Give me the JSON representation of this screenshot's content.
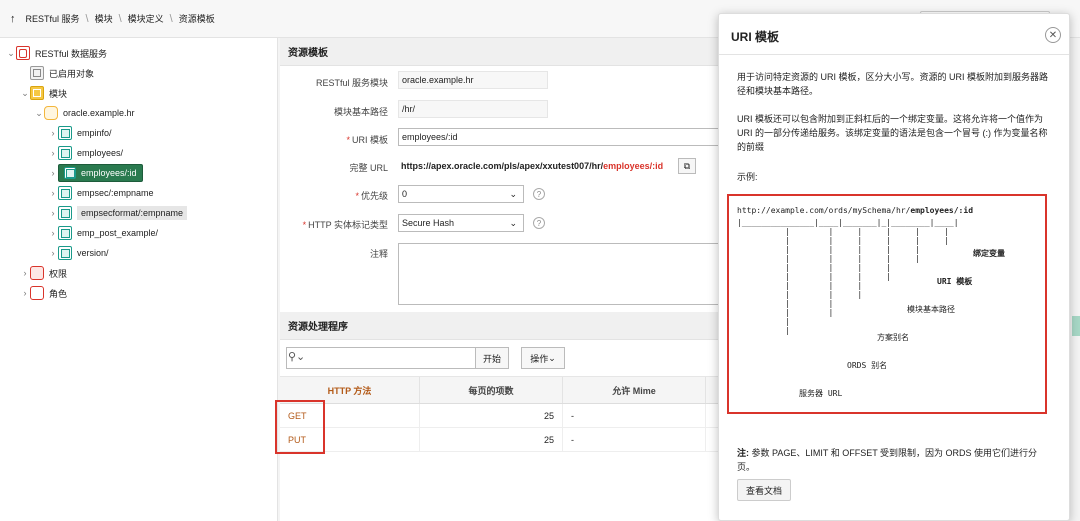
{
  "breadcrumb": {
    "items": [
      "RESTful 服务",
      "模块",
      "模块定义",
      "资源模板"
    ]
  },
  "tree": {
    "root": "RESTful 数据服务",
    "enabled_objects": "已启用对象",
    "modules": "模块",
    "module": "oracle.example.hr",
    "templates": [
      "empinfo/",
      "employees/",
      "employees/:id",
      "empsec/:empname",
      "empsecformat/:empname",
      "emp_post_example/",
      "version/"
    ],
    "selected": "employees/:id",
    "privileges": "权限",
    "roles": "角色"
  },
  "form": {
    "title": "资源模板",
    "module_label": "RESTful 服务模块",
    "module_value": "oracle.example.hr",
    "base_path_label": "模块基本路径",
    "base_path_value": "/hr/",
    "uri_label": "URI 模板",
    "uri_value": "employees/:id",
    "full_url_label": "完整 URL",
    "full_url_prefix": "https://apex.oracle.com/pls/apex/xxutest007/hr/",
    "full_url_suffix": "employees/:id",
    "priority_label": "优先级",
    "priority_value": "0",
    "etag_label": "HTTP 实体标记类型",
    "etag_value": "Secure Hash",
    "comments_label": "注释"
  },
  "handlers": {
    "title": "资源处理程序",
    "go_button": "开始",
    "actions_button": "操作",
    "columns": [
      "HTTP 方法",
      "每页的项数",
      "允许 Mime"
    ],
    "rows": [
      {
        "method": "GET",
        "items": "25",
        "mime": "-"
      },
      {
        "method": "PUT",
        "items": "25",
        "mime": "-"
      }
    ]
  },
  "dialog": {
    "title": "URI 模板",
    "para1": "用于访问特定资源的 URI 模板，区分大小写。资源的 URI 模板附加到服务器路径和模块基本路径。",
    "para2": "URI 模板还可以包含附加到正斜杠后的一个绑定变量。这将允许将一个值作为 URI 的一部分传递给服务。该绑定变量的语法是包含一个冒号 (:) 作为变量名称的前缀",
    "example_label": "示例:",
    "code_url_prefix": "http://example.com/ords/mySchema/hr/",
    "code_url_bold": "employees/:id",
    "code_bind": "绑定变量",
    "code_uri_tpl": "URI 模板",
    "code_base_path": "模块基本路径",
    "code_schema": "方案别名",
    "code_ords": "ORDS 别名",
    "code_server": "服务器 URL",
    "note_prefix": "注:",
    "note_text": "参数 PAGE、LIMIT 和 OFFSET 受到限制，因为 ORDS 使用它们进行分页。",
    "doc_button": "查看文档"
  },
  "colors": {
    "accent_red": "#d9342b",
    "selected_green": "#2a7a4f",
    "method_orange": "#b35a18"
  }
}
